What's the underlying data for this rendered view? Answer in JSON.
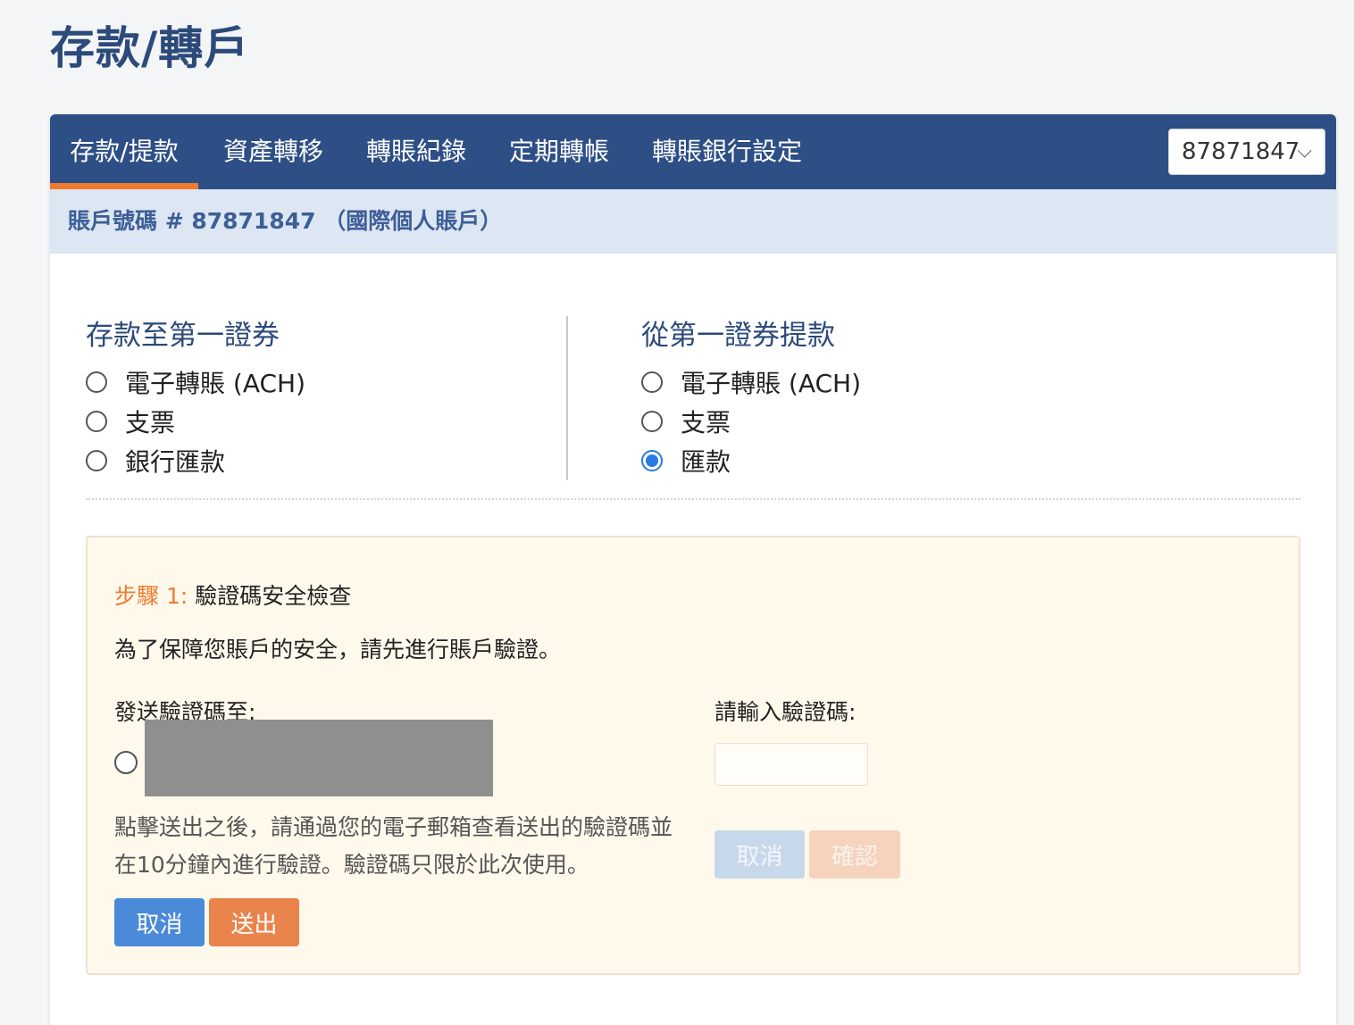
{
  "page_title": "存款/轉戶",
  "nav": {
    "tabs": [
      {
        "label": "存款/提款"
      },
      {
        "label": "資產轉移"
      },
      {
        "label": "轉賬紀錄"
      },
      {
        "label": "定期轉帳"
      },
      {
        "label": "轉賬銀行設定"
      }
    ],
    "active_tab": "存款/提款",
    "account_select": {
      "value": "87871847"
    }
  },
  "account_bar": {
    "text": "賬戶號碼 # 87871847 （國際個人賬戶）"
  },
  "deposit": {
    "title": "存款至第一證券",
    "options": [
      {
        "label": "電子轉賬 (ACH)",
        "checked": false
      },
      {
        "label": "支票",
        "checked": false
      },
      {
        "label": "銀行匯款",
        "checked": false
      }
    ]
  },
  "withdraw": {
    "title": "從第一證券提款",
    "options": [
      {
        "label": "電子轉賬 (ACH)",
        "checked": false
      },
      {
        "label": "支票",
        "checked": false
      },
      {
        "label": "匯款",
        "checked": true
      }
    ]
  },
  "verification": {
    "step_label": "步驟 1:",
    "step_title": "驗證碼安全檢查",
    "intro": "為了保障您賬戶的安全，請先進行賬戶驗證。",
    "send_to_label": "發送驗證碼至:",
    "note": "點擊送出之後，請通過您的電子郵箱查看送出的驗證碼並在10分鐘內進行驗證。驗證碼只限於此次使用。",
    "cancel_label": "取消",
    "send_label": "送出",
    "enter_code_label": "請輸入驗證碼:",
    "code_value": "",
    "cancel2_label": "取消",
    "confirm_label": "確認"
  },
  "colors": {
    "nav_bg": "#2e4f86",
    "active_underline": "#f07b2f",
    "title": "#2c4a7a",
    "radio_checked": "#2a7ae2"
  }
}
